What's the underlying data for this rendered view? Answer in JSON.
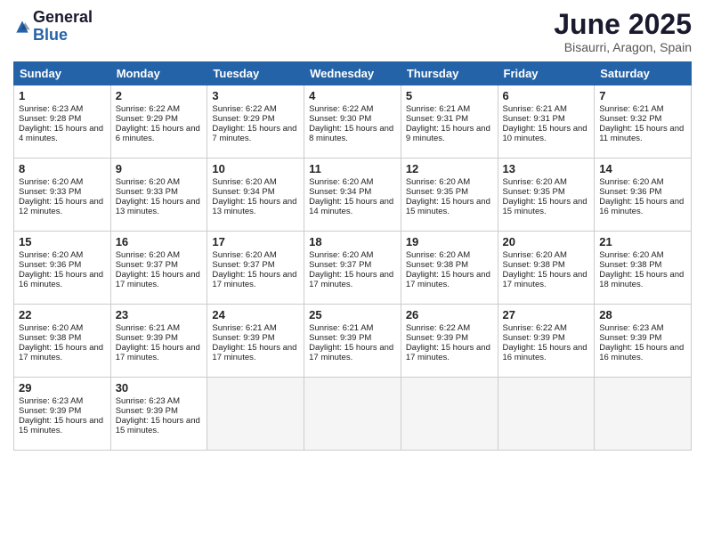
{
  "logo": {
    "general": "General",
    "blue": "Blue"
  },
  "title": "June 2025",
  "subtitle": "Bisaurri, Aragon, Spain",
  "headers": [
    "Sunday",
    "Monday",
    "Tuesday",
    "Wednesday",
    "Thursday",
    "Friday",
    "Saturday"
  ],
  "weeks": [
    [
      {
        "day": "1",
        "sunrise": "6:23 AM",
        "sunset": "9:28 PM",
        "daylight": "15 hours and 4 minutes."
      },
      {
        "day": "2",
        "sunrise": "6:22 AM",
        "sunset": "9:29 PM",
        "daylight": "15 hours and 6 minutes."
      },
      {
        "day": "3",
        "sunrise": "6:22 AM",
        "sunset": "9:29 PM",
        "daylight": "15 hours and 7 minutes."
      },
      {
        "day": "4",
        "sunrise": "6:22 AM",
        "sunset": "9:30 PM",
        "daylight": "15 hours and 8 minutes."
      },
      {
        "day": "5",
        "sunrise": "6:21 AM",
        "sunset": "9:31 PM",
        "daylight": "15 hours and 9 minutes."
      },
      {
        "day": "6",
        "sunrise": "6:21 AM",
        "sunset": "9:31 PM",
        "daylight": "15 hours and 10 minutes."
      },
      {
        "day": "7",
        "sunrise": "6:21 AM",
        "sunset": "9:32 PM",
        "daylight": "15 hours and 11 minutes."
      }
    ],
    [
      {
        "day": "8",
        "sunrise": "6:20 AM",
        "sunset": "9:33 PM",
        "daylight": "15 hours and 12 minutes."
      },
      {
        "day": "9",
        "sunrise": "6:20 AM",
        "sunset": "9:33 PM",
        "daylight": "15 hours and 13 minutes."
      },
      {
        "day": "10",
        "sunrise": "6:20 AM",
        "sunset": "9:34 PM",
        "daylight": "15 hours and 13 minutes."
      },
      {
        "day": "11",
        "sunrise": "6:20 AM",
        "sunset": "9:34 PM",
        "daylight": "15 hours and 14 minutes."
      },
      {
        "day": "12",
        "sunrise": "6:20 AM",
        "sunset": "9:35 PM",
        "daylight": "15 hours and 15 minutes."
      },
      {
        "day": "13",
        "sunrise": "6:20 AM",
        "sunset": "9:35 PM",
        "daylight": "15 hours and 15 minutes."
      },
      {
        "day": "14",
        "sunrise": "6:20 AM",
        "sunset": "9:36 PM",
        "daylight": "15 hours and 16 minutes."
      }
    ],
    [
      {
        "day": "15",
        "sunrise": "6:20 AM",
        "sunset": "9:36 PM",
        "daylight": "15 hours and 16 minutes."
      },
      {
        "day": "16",
        "sunrise": "6:20 AM",
        "sunset": "9:37 PM",
        "daylight": "15 hours and 17 minutes."
      },
      {
        "day": "17",
        "sunrise": "6:20 AM",
        "sunset": "9:37 PM",
        "daylight": "15 hours and 17 minutes."
      },
      {
        "day": "18",
        "sunrise": "6:20 AM",
        "sunset": "9:37 PM",
        "daylight": "15 hours and 17 minutes."
      },
      {
        "day": "19",
        "sunrise": "6:20 AM",
        "sunset": "9:38 PM",
        "daylight": "15 hours and 17 minutes."
      },
      {
        "day": "20",
        "sunrise": "6:20 AM",
        "sunset": "9:38 PM",
        "daylight": "15 hours and 17 minutes."
      },
      {
        "day": "21",
        "sunrise": "6:20 AM",
        "sunset": "9:38 PM",
        "daylight": "15 hours and 18 minutes."
      }
    ],
    [
      {
        "day": "22",
        "sunrise": "6:20 AM",
        "sunset": "9:38 PM",
        "daylight": "15 hours and 17 minutes."
      },
      {
        "day": "23",
        "sunrise": "6:21 AM",
        "sunset": "9:39 PM",
        "daylight": "15 hours and 17 minutes."
      },
      {
        "day": "24",
        "sunrise": "6:21 AM",
        "sunset": "9:39 PM",
        "daylight": "15 hours and 17 minutes."
      },
      {
        "day": "25",
        "sunrise": "6:21 AM",
        "sunset": "9:39 PM",
        "daylight": "15 hours and 17 minutes."
      },
      {
        "day": "26",
        "sunrise": "6:22 AM",
        "sunset": "9:39 PM",
        "daylight": "15 hours and 17 minutes."
      },
      {
        "day": "27",
        "sunrise": "6:22 AM",
        "sunset": "9:39 PM",
        "daylight": "15 hours and 16 minutes."
      },
      {
        "day": "28",
        "sunrise": "6:23 AM",
        "sunset": "9:39 PM",
        "daylight": "15 hours and 16 minutes."
      }
    ],
    [
      {
        "day": "29",
        "sunrise": "6:23 AM",
        "sunset": "9:39 PM",
        "daylight": "15 hours and 15 minutes."
      },
      {
        "day": "30",
        "sunrise": "6:23 AM",
        "sunset": "9:39 PM",
        "daylight": "15 hours and 15 minutes."
      },
      null,
      null,
      null,
      null,
      null
    ]
  ]
}
